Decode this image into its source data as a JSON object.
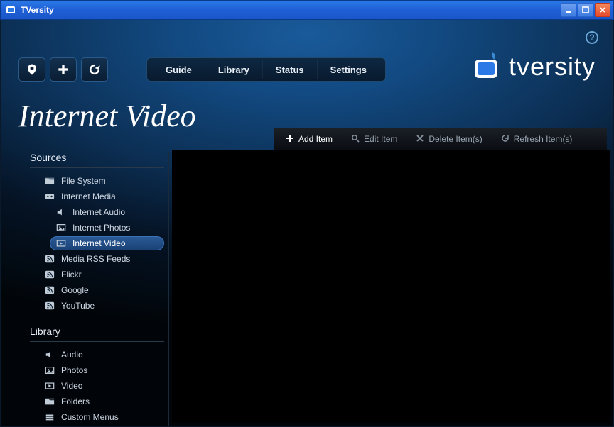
{
  "window": {
    "title": "TVersity"
  },
  "brand": {
    "text": "tversity"
  },
  "nav": {
    "tabs": [
      {
        "label": "Guide"
      },
      {
        "label": "Library"
      },
      {
        "label": "Status"
      },
      {
        "label": "Settings"
      }
    ]
  },
  "page": {
    "title": "Internet Video"
  },
  "actions": {
    "add": {
      "label": "Add Item",
      "enabled": true
    },
    "edit": {
      "label": "Edit Item",
      "enabled": false
    },
    "delete": {
      "label": "Delete Item(s)",
      "enabled": false
    },
    "refresh": {
      "label": "Refresh Item(s)",
      "enabled": false
    }
  },
  "sidebar": {
    "sources_title": "Sources",
    "library_title": "Library",
    "sources": [
      {
        "label": "File System",
        "icon": "folder-icon"
      },
      {
        "label": "Internet Media",
        "icon": "globe-icon"
      },
      {
        "label": "Internet Audio",
        "icon": "speaker-icon",
        "child": true
      },
      {
        "label": "Internet Photos",
        "icon": "photo-icon",
        "child": true
      },
      {
        "label": "Internet Video",
        "icon": "video-icon",
        "child": true,
        "selected": true
      },
      {
        "label": "Media RSS Feeds",
        "icon": "rss-icon"
      },
      {
        "label": "Flickr",
        "icon": "rss-icon"
      },
      {
        "label": "Google",
        "icon": "rss-icon"
      },
      {
        "label": "YouTube",
        "icon": "rss-icon"
      }
    ],
    "library": [
      {
        "label": "Audio",
        "icon": "speaker-icon"
      },
      {
        "label": "Photos",
        "icon": "photo-icon"
      },
      {
        "label": "Video",
        "icon": "video-icon"
      },
      {
        "label": "Folders",
        "icon": "folder-icon"
      },
      {
        "label": "Custom Menus",
        "icon": "menu-icon"
      }
    ]
  }
}
